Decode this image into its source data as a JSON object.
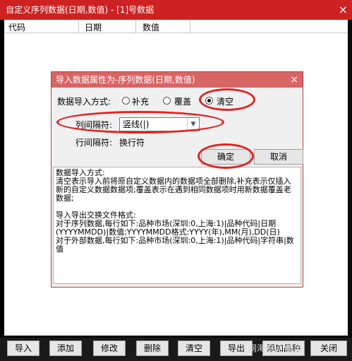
{
  "window": {
    "title": "自定义序列数据(日期,数值) - [1]号数据",
    "close_glyph": "×"
  },
  "columns": [
    "代码",
    "日期",
    "数值"
  ],
  "toolbar": {
    "buttons": [
      "导入",
      "添加",
      "修改",
      "删除",
      "清空",
      "导出",
      "添加品种",
      "关闭"
    ]
  },
  "watermark": "网海拾贝 量化",
  "dialog": {
    "title": "导入数据属性为-序列数据(日期,数值)",
    "close_glyph": "×",
    "import_mode_label": "数据导入方式:",
    "radio_options": [
      {
        "label": "补充",
        "checked": false
      },
      {
        "label": "覆盖",
        "checked": false
      },
      {
        "label": "清空",
        "checked": true
      }
    ],
    "col_sep_label": "列间隔符:",
    "col_sep_value": "竖线(|)",
    "row_sep_label": "行间隔符:",
    "row_sep_value": "换行符",
    "ok_label": "确定",
    "cancel_label": "取消",
    "info_lines": [
      "数据导入方式:",
      "     清空表示导入前将原自定义数据内的数据项全部删除,补充表示仅插入新的自定义数据数据项;覆盖表示在遇到相同数据项时用新数据覆盖老数据;",
      "",
      "导入导出交换文件格式:",
      "     对于序列数据,每行如下:品种市场(深圳:0,上海:1)|品种代码|日期(YYYYMMDD)|数值;YYYYMMDD格式:YYYY(年),MM(月),DD(日)",
      "     对于外部数据,每行如下:品种市场(深圳:0,上海:1)|品种代码|字符串|数值"
    ]
  },
  "accent_color": "#e32222"
}
